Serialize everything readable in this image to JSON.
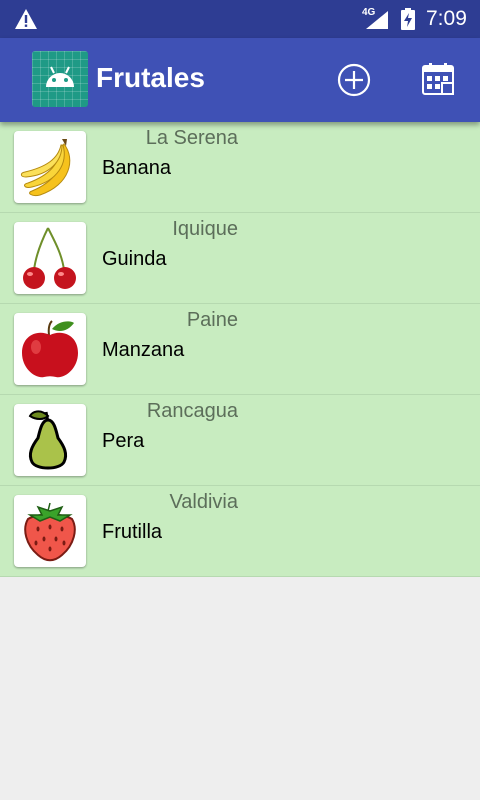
{
  "status_bar": {
    "network": "4G",
    "time": "7:09"
  },
  "app_bar": {
    "title": "Frutales",
    "actions": [
      "add-circle-icon",
      "calendar-icon"
    ]
  },
  "fruits": [
    {
      "name": "Banana",
      "city": "La Serena",
      "icon": "banana-icon"
    },
    {
      "name": "Guinda",
      "city": "Iquique",
      "icon": "cherry-icon"
    },
    {
      "name": "Manzana",
      "city": "Paine",
      "icon": "apple-icon"
    },
    {
      "name": "Pera",
      "city": "Rancagua",
      "icon": "pear-icon"
    },
    {
      "name": "Frutilla",
      "city": "Valdivia",
      "icon": "strawberry-icon"
    }
  ],
  "colors": {
    "status_bar": "#2e3d93",
    "app_bar": "#3f51b5",
    "list_background": "#c8ecc0",
    "page_background": "#eeeeee"
  }
}
